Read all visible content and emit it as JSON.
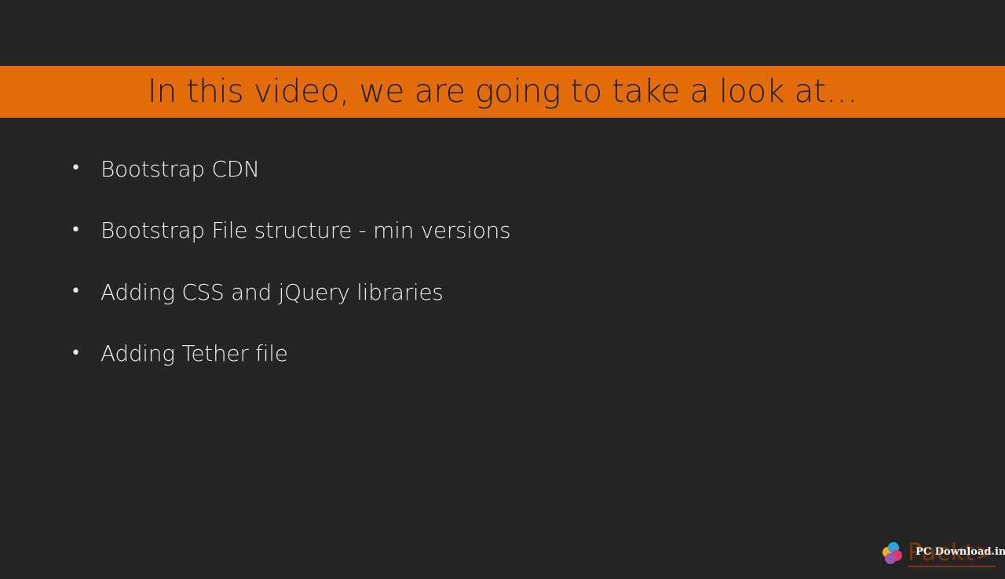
{
  "slide": {
    "title": "In this video, we are going to take a look at…",
    "bullets": [
      "Bootstrap CDN",
      "Bootstrap File structure - min versions",
      "Adding CSS and jQuery libraries",
      "Adding Tether file"
    ],
    "bullet_glyph": "•"
  },
  "watermark": {
    "brand": "Packt>",
    "site": "PC Download.in"
  },
  "colors": {
    "background": "#252525",
    "title_bar": "#e36c0a",
    "title_text": "#1e1e1e",
    "bullet_text": "#eeeeee"
  }
}
